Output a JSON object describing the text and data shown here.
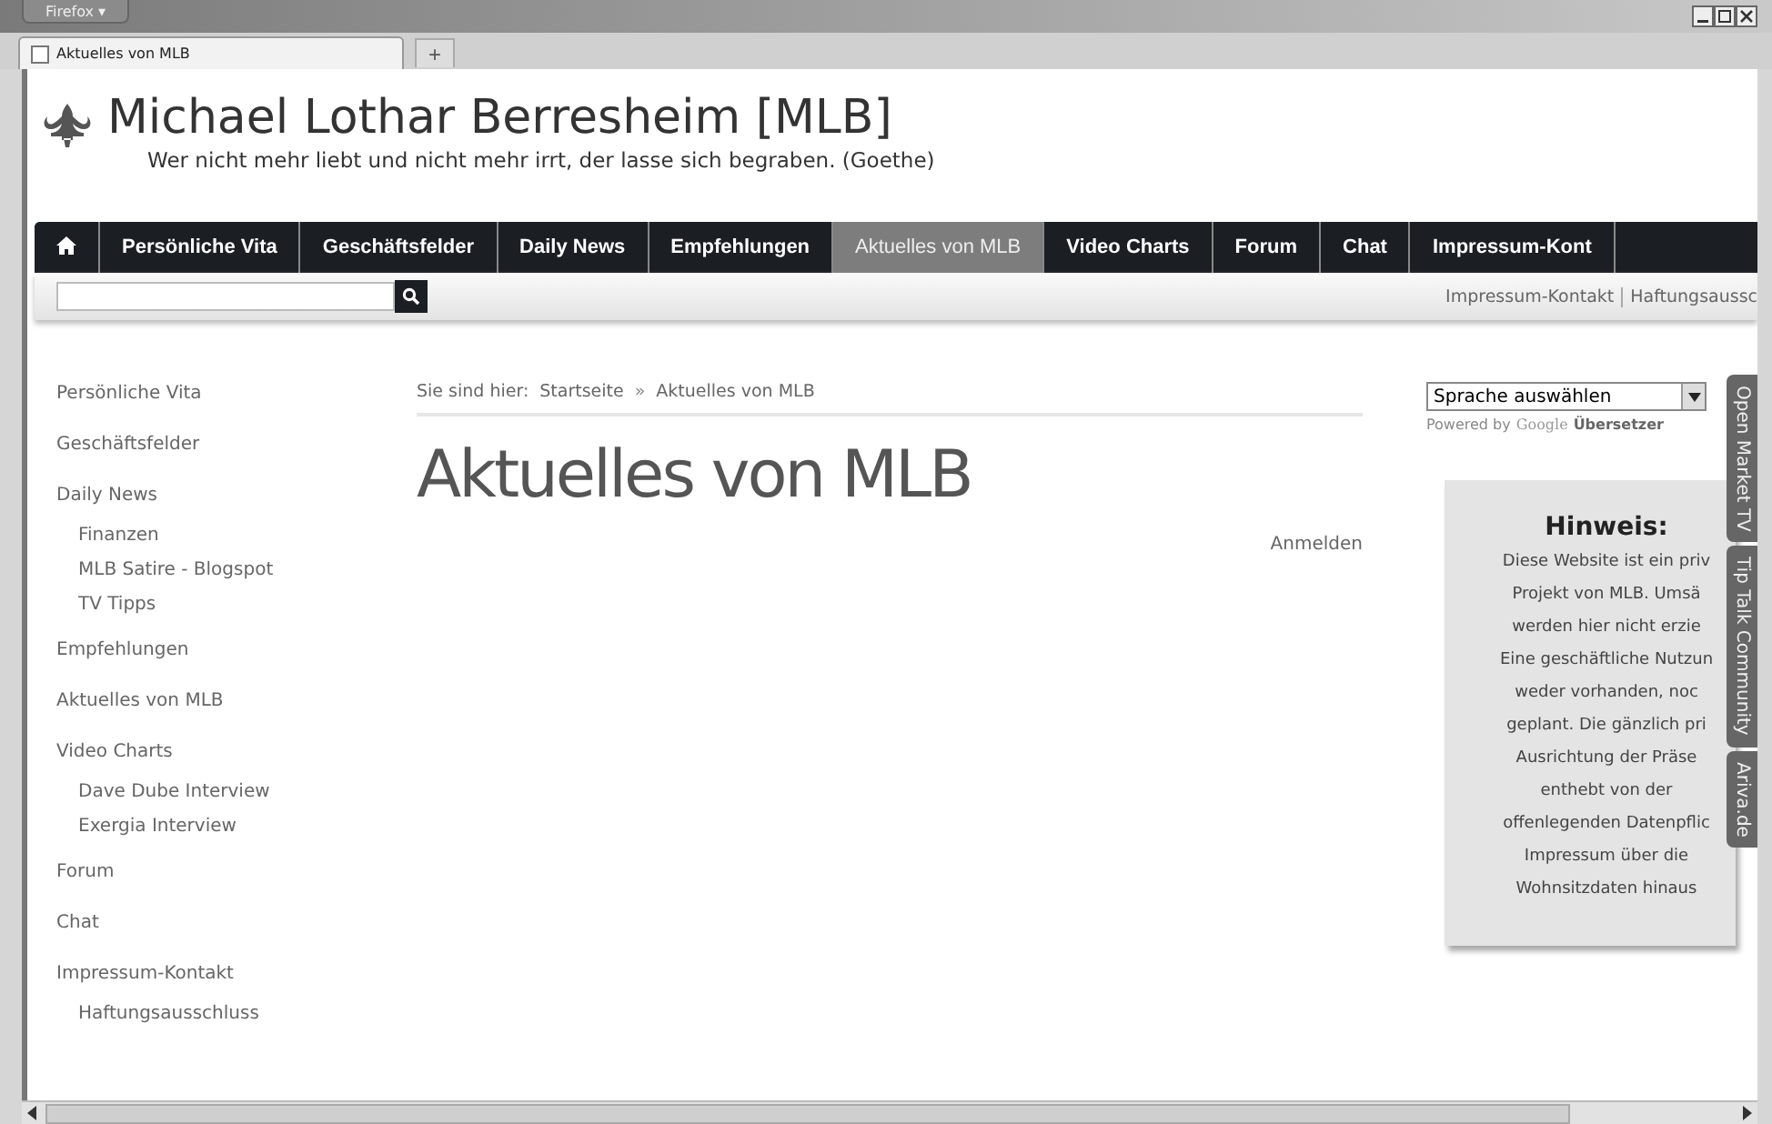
{
  "browser": {
    "menu_button": "Firefox ▾",
    "tab_title": "Aktuelles von MLB",
    "new_tab": "+"
  },
  "site": {
    "title": "Michael Lothar Berresheim [MLB]",
    "tagline": "Wer nicht mehr liebt und nicht mehr irrt, der lasse sich begraben. (Goethe)"
  },
  "nav": [
    {
      "label": "Persönliche Vita",
      "selected": false
    },
    {
      "label": "Geschäftsfelder",
      "selected": false
    },
    {
      "label": "Daily News",
      "selected": false
    },
    {
      "label": "Empfehlungen",
      "selected": false
    },
    {
      "label": "Aktuelles von MLB",
      "selected": true
    },
    {
      "label": "Video Charts",
      "selected": false
    },
    {
      "label": "Forum",
      "selected": false
    },
    {
      "label": "Chat",
      "selected": false
    },
    {
      "label": "Impressum-Kont",
      "selected": false
    }
  ],
  "top_links": [
    "Impressum-Kontakt",
    "Haftungsaussc"
  ],
  "sidebar": [
    {
      "label": "Persönliche Vita"
    },
    {
      "label": "Geschäftsfelder"
    },
    {
      "label": "Daily News",
      "children": [
        {
          "label": "Finanzen"
        },
        {
          "label": "MLB Satire - Blogspot"
        },
        {
          "label": "TV Tipps"
        }
      ]
    },
    {
      "label": "Empfehlungen"
    },
    {
      "label": "Aktuelles von MLB"
    },
    {
      "label": "Video Charts",
      "children": [
        {
          "label": "Dave Dube Interview"
        },
        {
          "label": "Exergia Interview"
        }
      ]
    },
    {
      "label": "Forum"
    },
    {
      "label": "Chat"
    },
    {
      "label": "Impressum-Kontakt",
      "children": [
        {
          "label": "Haftungsausschluss"
        }
      ]
    }
  ],
  "breadcrumb": {
    "prefix": "Sie sind hier:",
    "items": [
      "Startseite",
      "Aktuelles von MLB"
    ],
    "separator": "»"
  },
  "heading": "Aktuelles von MLB",
  "login_link": "Anmelden",
  "translate": {
    "select": "Sprache auswählen",
    "powered_by": "Powered by",
    "brand": "Google",
    "service": "Übersetzer"
  },
  "notice": {
    "title": "Hinweis:",
    "lines": [
      "Diese Website ist ein priv",
      "Projekt von MLB. Umsä",
      "werden hier nicht erzie",
      "Eine geschäftliche Nutzun",
      "weder vorhanden, noc",
      "geplant. Die gänzlich pri",
      "Ausrichtung der Präse",
      "enthebt von der",
      "offenlegenden Datenpflic",
      "Impressum über die",
      "Wohnsitzdaten hinaus"
    ]
  },
  "side_tabs": [
    "Open Market TV",
    "Tip Talk Community",
    "Ariva.de"
  ]
}
